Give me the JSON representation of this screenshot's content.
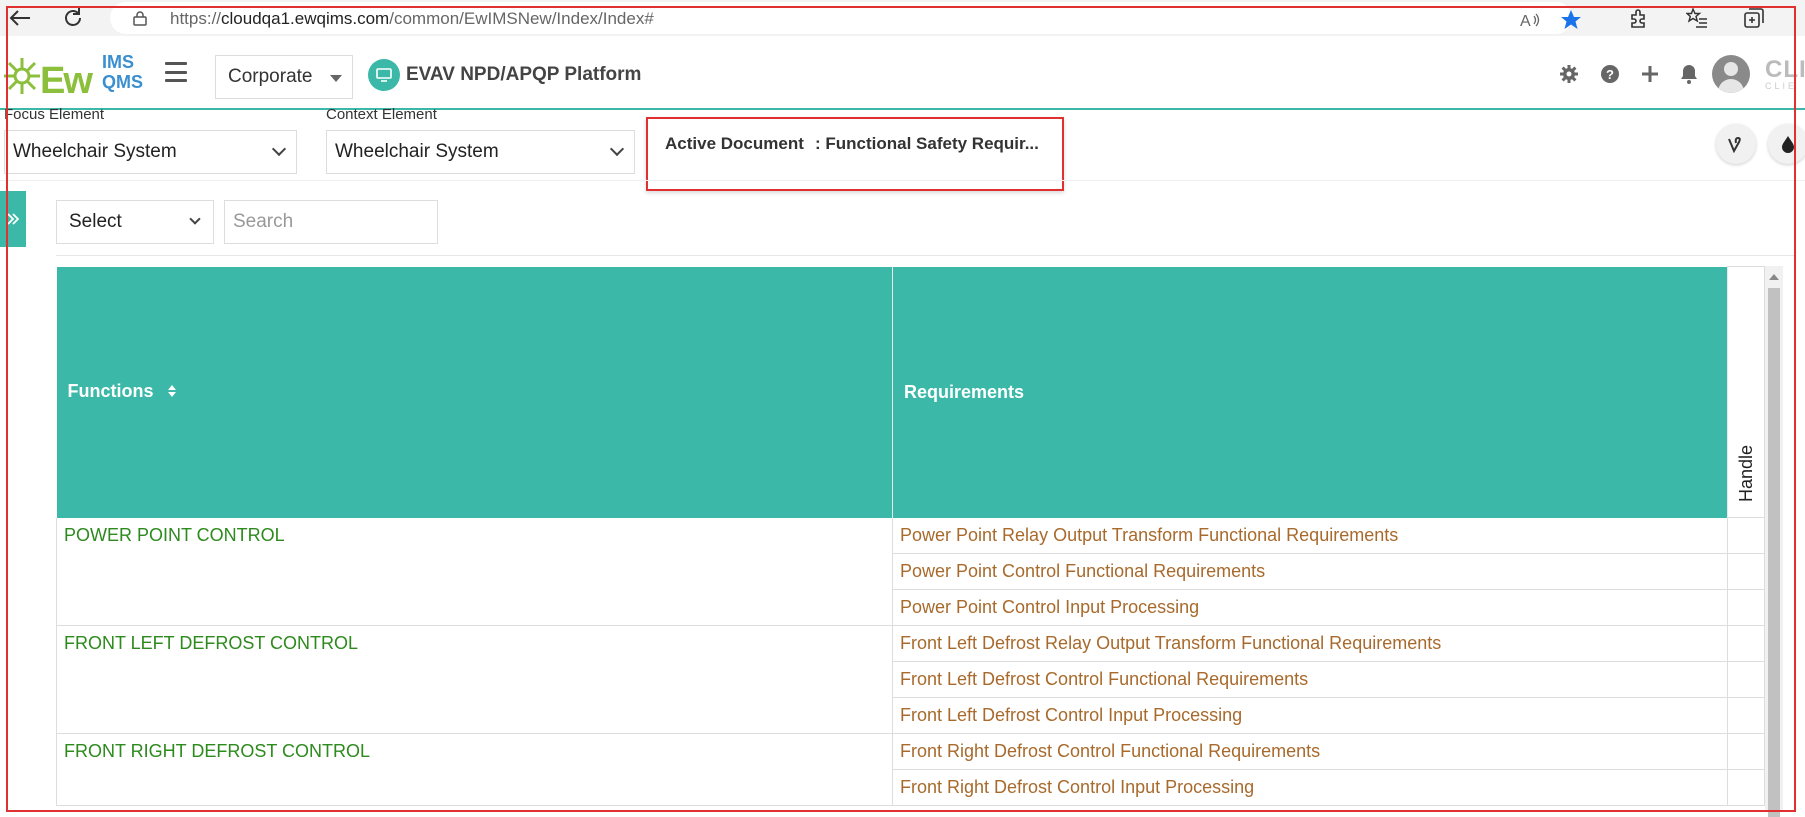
{
  "browser": {
    "url_prefix": "https://",
    "url_host": "cloudqa1.ewqims.com",
    "url_path": "/common/EwIMSNew/Index/Index#"
  },
  "header": {
    "logo_ew": "Ew",
    "logo_ims": "IMS",
    "logo_qms": "QMS",
    "org_select": "Corporate",
    "platform_label": "EVAV NPD/APQP Platform",
    "client_text": "CLIE",
    "client_sub": "CLIE"
  },
  "selectors": {
    "focus_label": "Focus Element",
    "focus_value": "Wheelchair System",
    "context_label": "Context Element",
    "context_value": "Wheelchair System",
    "active_doc_label": "Active Document",
    "active_doc_value": ": Functional Safety Requir..."
  },
  "filter": {
    "select_value": "Select",
    "search_placeholder": "Search"
  },
  "table": {
    "col_functions": "Functions",
    "col_requirements": "Requirements",
    "col_handle": "Handle",
    "groups": [
      {
        "function": "POWER POINT CONTROL",
        "requirements": [
          "Power Point Relay Output Transform Functional Requirements",
          "Power Point Control Functional Requirements",
          "Power Point Control Input Processing"
        ]
      },
      {
        "function": "FRONT LEFT DEFROST CONTROL",
        "requirements": [
          "Front Left Defrost Relay Output Transform Functional Requirements",
          "Front Left Defrost Control Functional Requirements",
          "Front Left Defrost Control Input Processing"
        ]
      },
      {
        "function": "FRONT RIGHT DEFROST CONTROL",
        "requirements": [
          "Front Right Defrost Control Functional Requirements",
          "Front Right Defrost Control Input Processing"
        ]
      }
    ]
  },
  "colors": {
    "accent": "#3bb8a8",
    "function_text": "#2d8a1d",
    "requirement_text": "#a86a2c",
    "annotation_red": "#e03030"
  }
}
